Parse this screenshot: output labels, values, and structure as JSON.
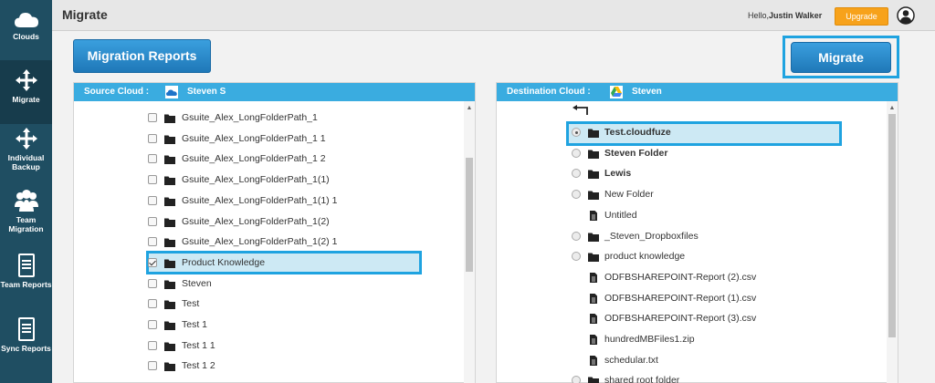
{
  "sidebar": {
    "items": [
      {
        "label": "Clouds",
        "icon": "cloud-icon"
      },
      {
        "label": "Migrate",
        "icon": "move-arrows-icon"
      },
      {
        "label": "Individual Backup",
        "icon": "move-arrows-icon"
      },
      {
        "label": "Team Migration",
        "icon": "team-icon"
      },
      {
        "label": "Team Reports",
        "icon": "document-icon"
      },
      {
        "label": "Sync Reports",
        "icon": "document-icon"
      }
    ]
  },
  "header": {
    "title": "Migrate",
    "greeting_prefix": "Hello,",
    "user_name": "Justin Walker",
    "upgrade_label": "Upgrade"
  },
  "toolbar": {
    "reports_label": "Migration Reports",
    "migrate_label": "Migrate"
  },
  "source": {
    "header_label": "Source Cloud :",
    "account_name": "Steven S",
    "items": [
      {
        "name": "Gsuite_Alex_LongFolderPath_1",
        "checked": false
      },
      {
        "name": "Gsuite_Alex_LongFolderPath_1 1",
        "checked": false
      },
      {
        "name": "Gsuite_Alex_LongFolderPath_1 2",
        "checked": false
      },
      {
        "name": "Gsuite_Alex_LongFolderPath_1(1)",
        "checked": false
      },
      {
        "name": "Gsuite_Alex_LongFolderPath_1(1) 1",
        "checked": false
      },
      {
        "name": "Gsuite_Alex_LongFolderPath_1(2)",
        "checked": false
      },
      {
        "name": "Gsuite_Alex_LongFolderPath_1(2) 1",
        "checked": false
      },
      {
        "name": "Product Knowledge",
        "checked": true
      },
      {
        "name": "Steven",
        "checked": false
      },
      {
        "name": "Test",
        "checked": false
      },
      {
        "name": "Test 1",
        "checked": false
      },
      {
        "name": "Test 1 1",
        "checked": false
      },
      {
        "name": "Test 1 2",
        "checked": false
      }
    ]
  },
  "destination": {
    "header_label": "Destination Cloud :",
    "account_name": "Steven",
    "items": [
      {
        "name": "Test.cloudfuze",
        "type": "folder",
        "selected": true,
        "radio": true
      },
      {
        "name": "Steven Folder",
        "type": "folder",
        "selected": false,
        "radio": true
      },
      {
        "name": "Lewis",
        "type": "folder",
        "selected": false,
        "radio": true
      },
      {
        "name": "New Folder",
        "type": "folder",
        "selected": false,
        "radio": true
      },
      {
        "name": "Untitled",
        "type": "file",
        "selected": false,
        "radio": false
      },
      {
        "name": "_Steven_Dropboxfiles",
        "type": "folder",
        "selected": false,
        "radio": true
      },
      {
        "name": "product knowledge",
        "type": "folder",
        "selected": false,
        "radio": true
      },
      {
        "name": "ODFBSHAREPOINT-Report (2).csv",
        "type": "file",
        "selected": false,
        "radio": false
      },
      {
        "name": "ODFBSHAREPOINT-Report (1).csv",
        "type": "file",
        "selected": false,
        "radio": false
      },
      {
        "name": "ODFBSHAREPOINT-Report (3).csv",
        "type": "file",
        "selected": false,
        "radio": false
      },
      {
        "name": "hundredMBFiles1.zip",
        "type": "file",
        "selected": false,
        "radio": false
      },
      {
        "name": "schedular.txt",
        "type": "file",
        "selected": false,
        "radio": false
      },
      {
        "name": "shared root folder",
        "type": "folder",
        "selected": false,
        "radio": true
      }
    ]
  },
  "colors": {
    "sidebar": "#1f4e62",
    "panel_header": "#3aace0",
    "highlight": "#1fa3e0",
    "upgrade": "#f7a21b"
  }
}
